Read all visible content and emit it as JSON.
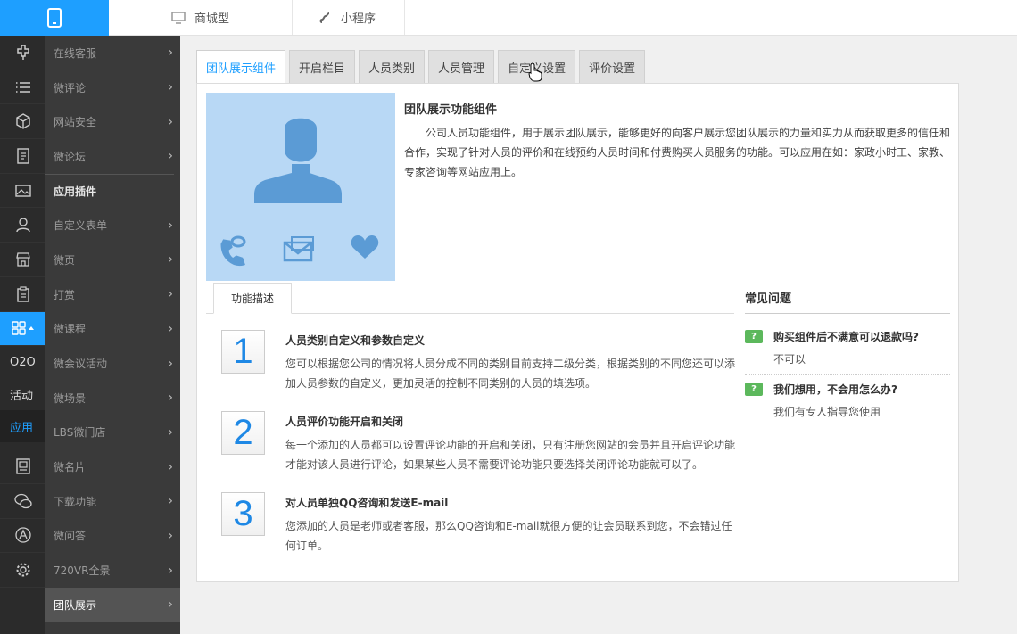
{
  "topbar": {
    "tabs": [
      {
        "label": "商城型",
        "icon": "monitor-icon"
      },
      {
        "label": "小程序",
        "icon": "mini-program-icon"
      }
    ]
  },
  "rail": {
    "text_items": [
      "O2O",
      "活动",
      "应用"
    ],
    "active_text": "应用"
  },
  "menu": {
    "items": [
      {
        "label": "在线客服"
      },
      {
        "label": "微评论"
      },
      {
        "label": "网站安全"
      },
      {
        "label": "微论坛"
      },
      {
        "label": "应用插件",
        "header": true
      },
      {
        "label": "自定义表单"
      },
      {
        "label": "微页"
      },
      {
        "label": "打赏"
      },
      {
        "label": "微课程"
      },
      {
        "label": "微会议活动"
      },
      {
        "label": "微场景"
      },
      {
        "label": "LBS微门店"
      },
      {
        "label": "微名片"
      },
      {
        "label": "下载功能"
      },
      {
        "label": "微问答"
      },
      {
        "label": "720VR全景"
      },
      {
        "label": "团队展示",
        "selected": true
      }
    ]
  },
  "tabs": [
    "团队展示组件",
    "开启栏目",
    "人员类别",
    "人员管理",
    "自定义设置",
    "评价设置"
  ],
  "active_tab": "团队展示组件",
  "intro": {
    "title": "团队展示功能组件",
    "text": "公司人员功能组件，用于展示团队展示，能够更好的向客户展示您团队展示的力量和实力从而获取更多的信任和合作，实现了针对人员的评价和在线预约人员时间和付费购买人员服务的功能。可以应用在如：家政小时工、家教、专家咨询等网站应用上。"
  },
  "subtab": "功能描述",
  "features": [
    {
      "num": "1",
      "title": "人员类别自定义和参数自定义",
      "desc": "您可以根据您公司的情况将人员分成不同的类别目前支持二级分类，根据类别的不同您还可以添加人员参数的自定义，更加灵活的控制不同类别的人员的填选项。"
    },
    {
      "num": "2",
      "title": "人员评价功能开启和关闭",
      "desc": "每一个添加的人员都可以设置评论功能的开启和关闭，只有注册您网站的会员并且开启评论功能才能对该人员进行评论，如果某些人员不需要评论功能只要选择关闭评论功能就可以了。"
    },
    {
      "num": "3",
      "title": "对人员单独QQ咨询和发送E-mail",
      "desc": "您添加的人员是老师或者客服，那么QQ咨询和E-mail就很方便的让会员联系到您，不会错过任何订单。"
    }
  ],
  "faq": {
    "heading": "常见问题",
    "items": [
      {
        "q": "购买组件后不满意可以退款吗?",
        "a": "不可以"
      },
      {
        "q": "我们想用，不会用怎么办?",
        "a": "我们有专人指导您使用"
      }
    ]
  },
  "colors": {
    "accent": "#1e9fff",
    "hero_bg": "#b8d8f5",
    "hero_icon": "#5b9bd5"
  }
}
